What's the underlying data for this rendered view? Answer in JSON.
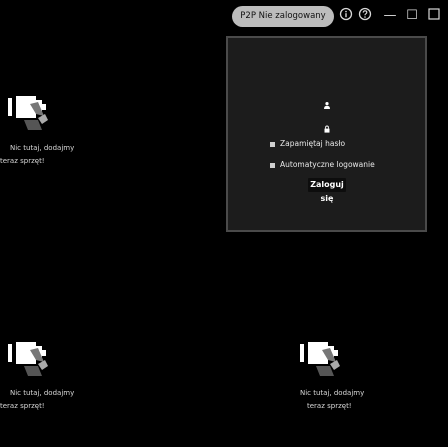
{
  "topbar": {
    "p2p_status": "P2P Nie zalogowany",
    "info_icon": "info-icon",
    "help_icon": "help-icon",
    "minimize_glyph": "—",
    "maximize_glyph": "☐"
  },
  "login": {
    "login_field": "",
    "password_field": "",
    "remember_label": "Zapamiętaj hasło",
    "autologin_label": "Automatyczne logowanie",
    "login_button": "Zaloguj się"
  },
  "tiles": [
    {
      "line1": "Nic tutaj, dodajmy",
      "line2": "teraz sprzęt!"
    },
    {
      "line1": "Nic tutaj, dodajmy",
      "line2": "teraz sprzęt!"
    },
    {
      "line1": "Nic tutaj, dodajmy",
      "line2": "teraz sprzęt!"
    }
  ]
}
